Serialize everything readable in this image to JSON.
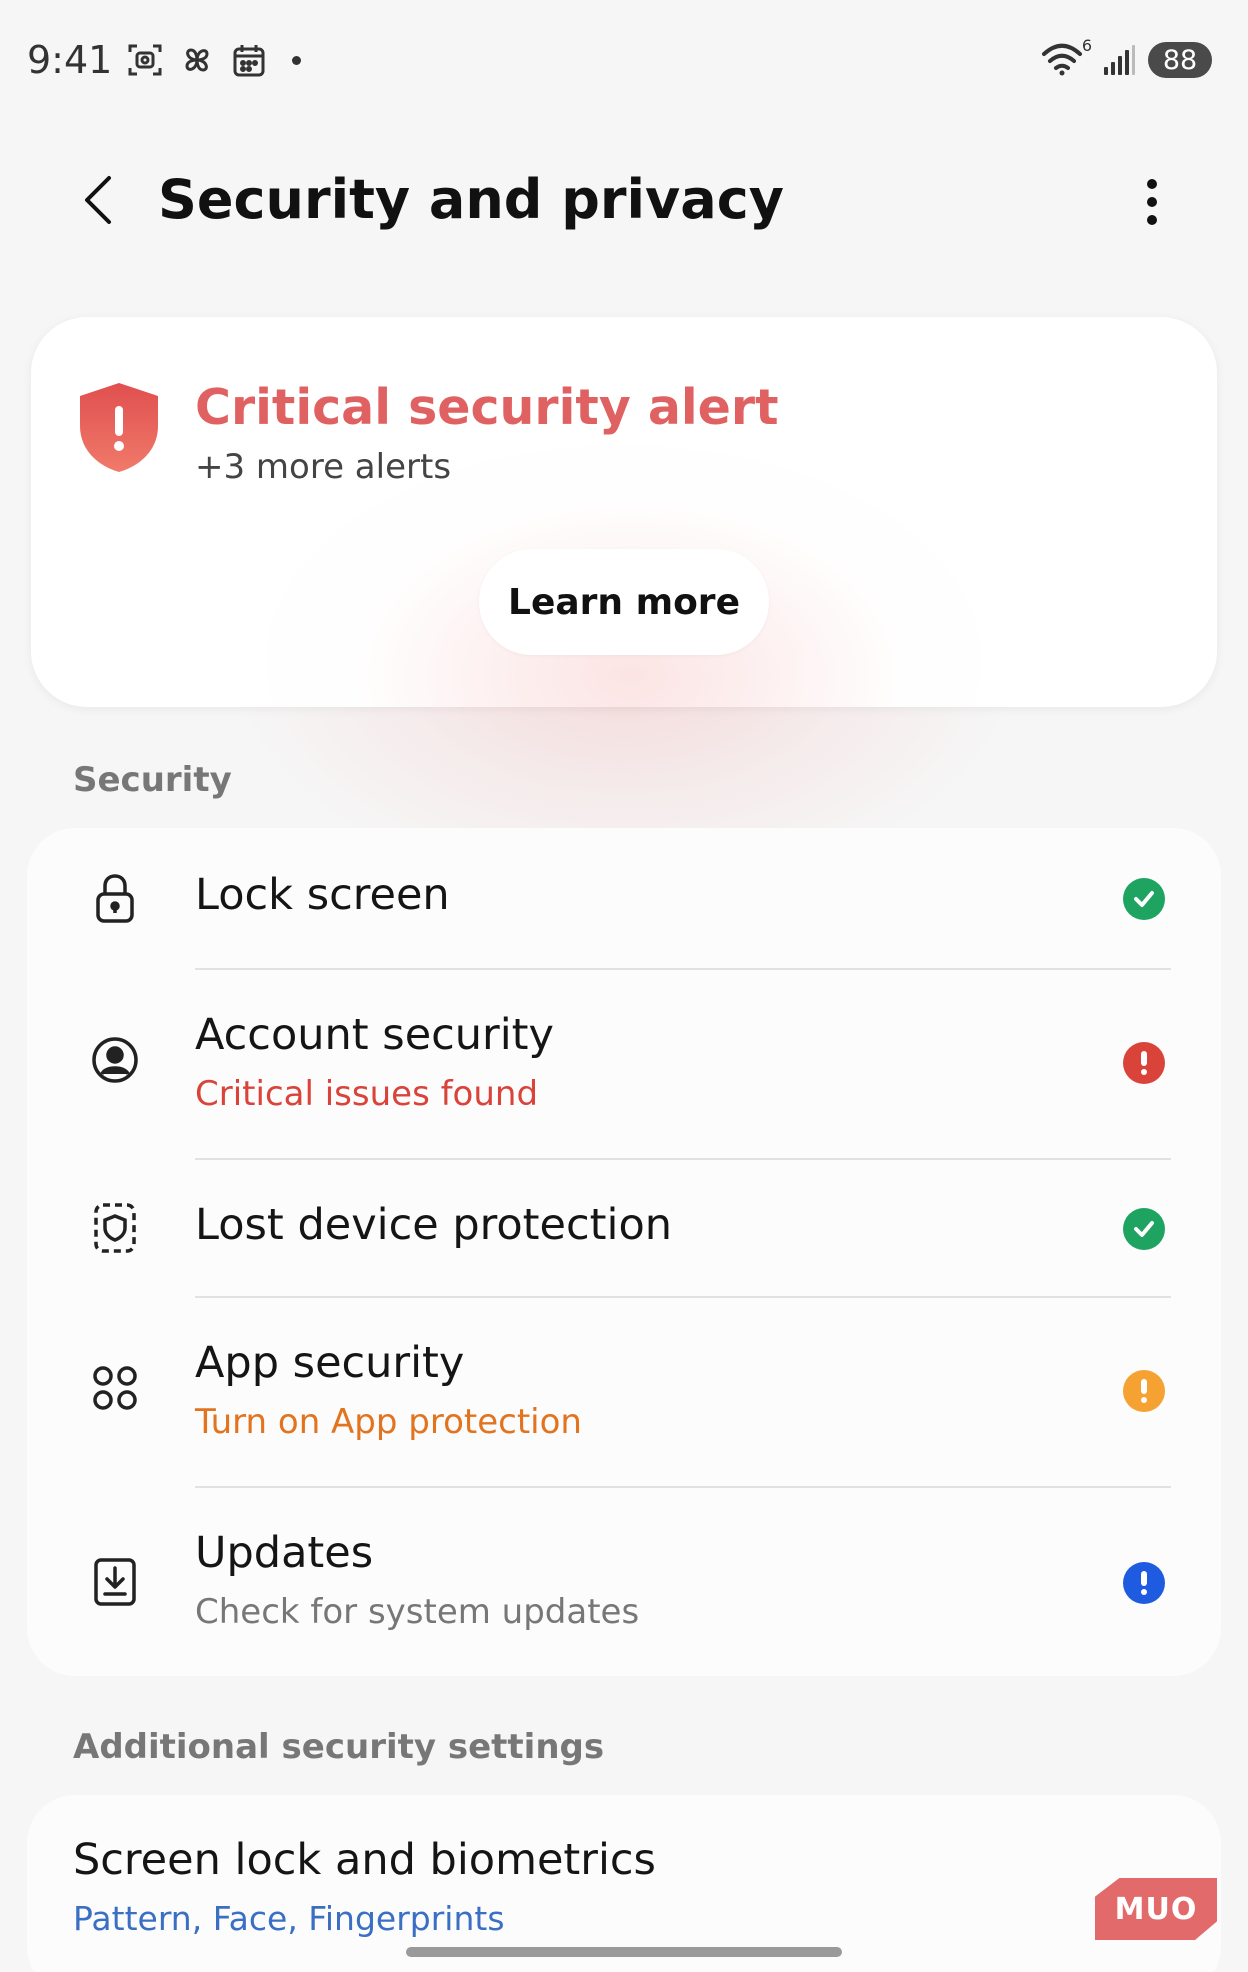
{
  "status_bar": {
    "time": "9:41",
    "notification_icons": [
      "screenshot-icon",
      "pinwheel-icon",
      "calendar-icon"
    ],
    "wifi_label": "6",
    "battery": "88"
  },
  "header": {
    "title": "Security and privacy",
    "back_icon": "chevron-left-icon",
    "more_icon": "more-vertical-icon"
  },
  "alert": {
    "title": "Critical security alert",
    "subtitle": "+3 more alerts",
    "button_label": "Learn more",
    "color": "#e06161"
  },
  "security": {
    "section_label": "Security",
    "items": [
      {
        "title": "Lock screen",
        "subtitle": "",
        "icon": "lock-icon",
        "status": "ok",
        "status_color": "#1ea361"
      },
      {
        "title": "Account security",
        "subtitle": "Critical issues found",
        "subtitle_color": "#d9433a",
        "icon": "account-icon",
        "status": "critical",
        "status_color": "#d9433a"
      },
      {
        "title": "Lost device protection",
        "subtitle": "",
        "icon": "find-device-icon",
        "status": "ok",
        "status_color": "#1ea361"
      },
      {
        "title": "App security",
        "subtitle": "Turn on App protection",
        "subtitle_color": "#e2741f",
        "icon": "app-grid-icon",
        "status": "warning",
        "status_color": "#f5a233"
      },
      {
        "title": "Updates",
        "subtitle": "Check for system updates",
        "subtitle_color": "#777777",
        "icon": "download-icon",
        "status": "info",
        "status_color": "#1f5be0"
      }
    ]
  },
  "additional": {
    "section_label": "Additional security settings",
    "item_title": "Screen lock and biometrics",
    "item_subtitle": "Pattern, Face, Fingerprints"
  },
  "watermark": "MUO"
}
